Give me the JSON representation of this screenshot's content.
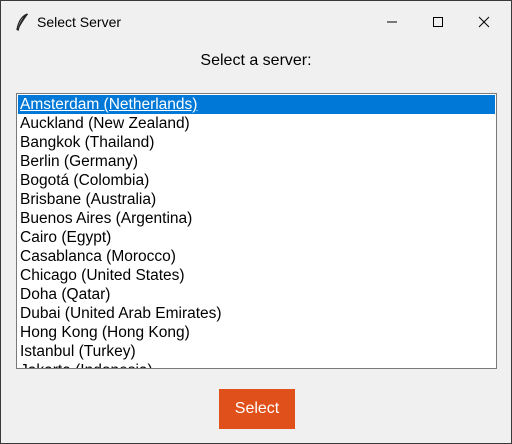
{
  "window": {
    "title": "Select Server",
    "app_icon": "feather-icon",
    "controls": {
      "minimize_icon": "minimize-icon",
      "maximize_icon": "maximize-icon",
      "close_icon": "close-icon"
    }
  },
  "prompt": "Select a server:",
  "servers": [
    "Amsterdam (Netherlands)",
    "Auckland (New Zealand)",
    "Bangkok (Thailand)",
    "Berlin (Germany)",
    "Bogotá (Colombia)",
    "Brisbane (Australia)",
    "Buenos Aires (Argentina)",
    "Cairo (Egypt)",
    "Casablanca (Morocco)",
    "Chicago (United States)",
    "Doha (Qatar)",
    "Dubai (United Arab Emirates)",
    "Hong Kong (Hong Kong)",
    "Istanbul (Turkey)",
    "Jakarta (Indonesia)"
  ],
  "selected_server": "Amsterdam (Netherlands)",
  "select_button_label": "Select",
  "colors": {
    "selection": "#0078d7",
    "button_background": "#e0501a",
    "window_background": "#f0f0f0"
  }
}
